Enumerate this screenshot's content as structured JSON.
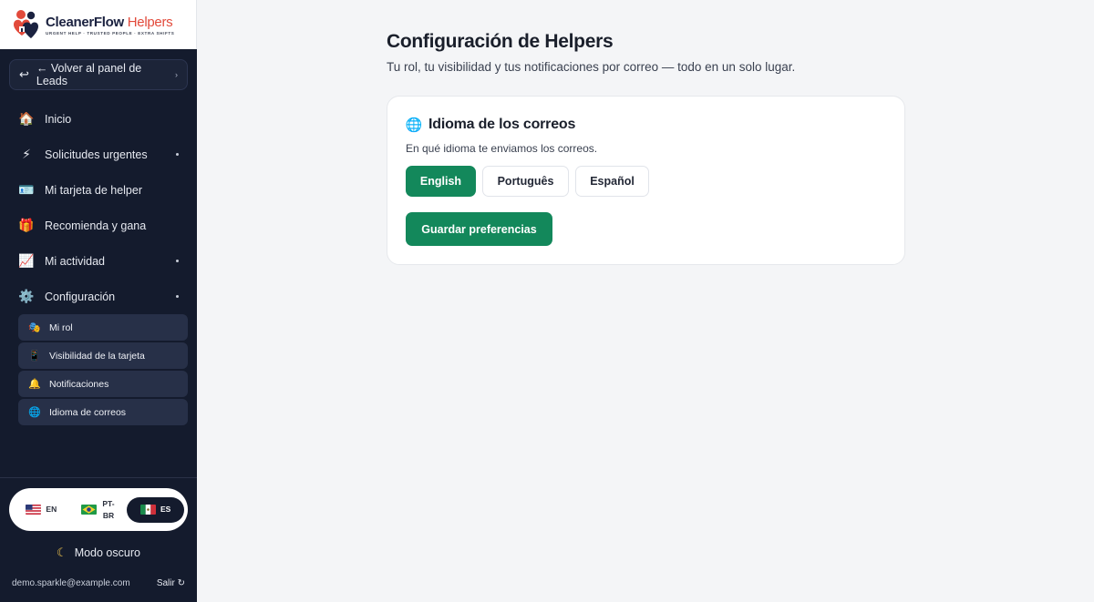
{
  "brand": {
    "name_main": "CleanerFlow",
    "name_accent": "Helpers",
    "tagline": "URGENT HELP · TRUSTED PEOPLE · EXTRA SHIFTS"
  },
  "sidebar": {
    "back_label": "← Volver al panel de Leads",
    "back_chevron": "›",
    "items": [
      {
        "label": "Inicio",
        "icon": "house-icon",
        "glyph": "🏠",
        "has_submenu": false
      },
      {
        "label": "Solicitudes urgentes",
        "icon": "lightning-icon",
        "glyph": "⚡",
        "has_submenu": true
      },
      {
        "label": "Mi tarjeta de helper",
        "icon": "id-card-icon",
        "glyph": "🪪",
        "has_submenu": false
      },
      {
        "label": "Recomienda y gana",
        "icon": "gift-icon",
        "glyph": "🎁",
        "has_submenu": false
      },
      {
        "label": "Mi actividad",
        "icon": "chart-icon",
        "glyph": "📈",
        "has_submenu": true
      },
      {
        "label": "Configuración",
        "icon": "gear-icon",
        "glyph": "⚙️",
        "has_submenu": true
      }
    ],
    "subitems": [
      {
        "label": "Mi rol",
        "icon": "role-icon",
        "glyph": "🎭"
      },
      {
        "label": "Visibilidad de la tarjeta",
        "icon": "phone-icon",
        "glyph": "📱"
      },
      {
        "label": "Notificaciones",
        "icon": "bell-icon",
        "glyph": "🔔"
      },
      {
        "label": "Idioma de correos",
        "icon": "globe-icon",
        "glyph": "🌐"
      }
    ],
    "languages": [
      {
        "code": "EN",
        "flag": "us-flag-icon",
        "active": false
      },
      {
        "code": "PT-BR",
        "flag": "br-flag-icon",
        "active": false
      },
      {
        "code": "ES",
        "flag": "mx-flag-icon",
        "active": true
      }
    ],
    "dark_mode_label": "Modo oscuro",
    "user_email": "demo.sparkle@example.com",
    "logout_label": "Salir ↻"
  },
  "main": {
    "title": "Configuración de Helpers",
    "subtitle": "Tu rol, tu visibilidad y tus notificaciones por correo — todo en un solo lugar.",
    "card": {
      "title": "Idioma de los correos",
      "description": "En qué idioma te enviamos los correos.",
      "options": [
        "English",
        "Português",
        "Español"
      ],
      "selected": "English",
      "save_label": "Guardar preferencias"
    }
  },
  "colors": {
    "sidebar_bg": "#141b2d",
    "accent_green": "#13885b",
    "brand_red": "#e24a3b"
  }
}
